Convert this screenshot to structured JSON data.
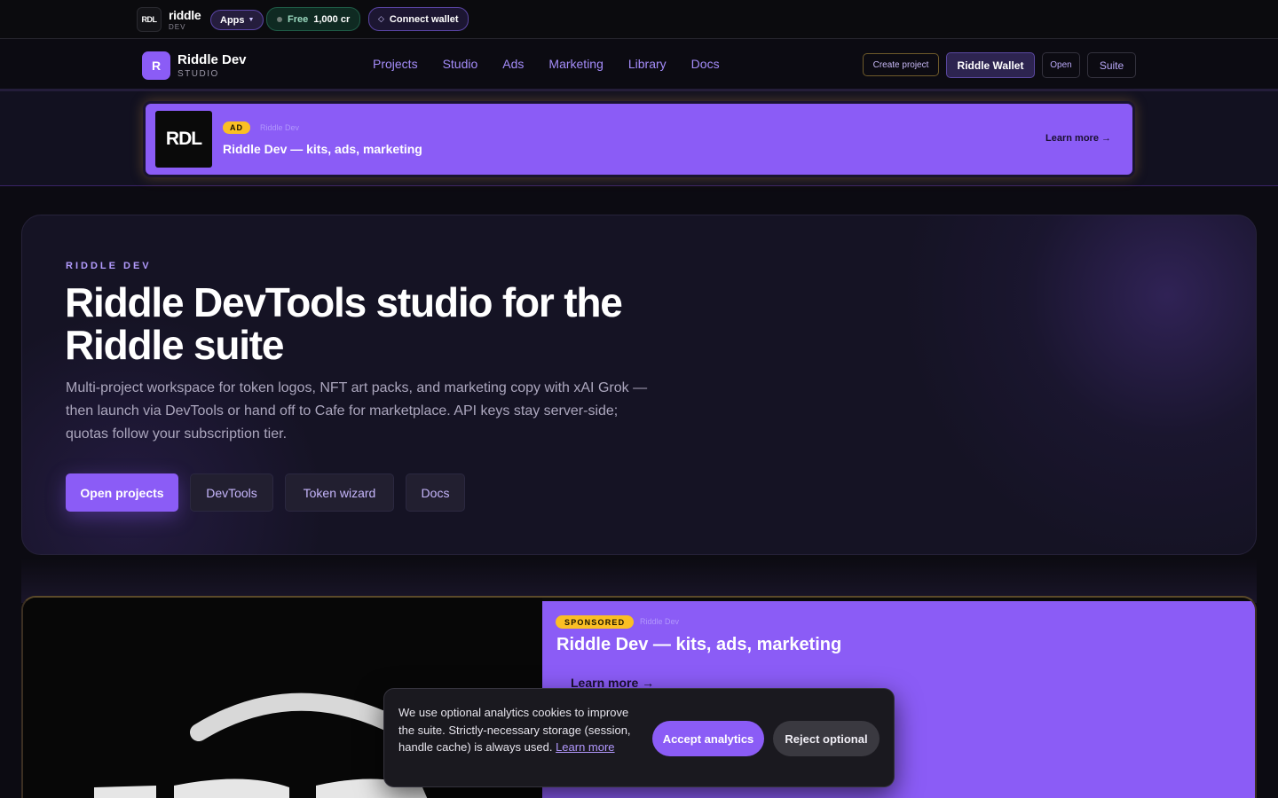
{
  "topstrip": {
    "brand_badge": "RDL",
    "brand_name": "riddle",
    "brand_sub": "DEV",
    "apps_label": "Apps",
    "free_label": "Free",
    "free_credits": "1,000 cr",
    "connect_wallet_label": "Connect wallet"
  },
  "nav": {
    "logo_letter": "R",
    "app_name": "Riddle Dev",
    "app_sub": "STUDIO",
    "links": [
      "Projects",
      "Studio",
      "Ads",
      "Marketing",
      "Library",
      "Docs"
    ],
    "create_project": "Create project",
    "riddle_wallet": "Riddle Wallet",
    "open": "Open",
    "suite": "Suite"
  },
  "ad_bar": {
    "logo_text": "RDL",
    "tag": "AD",
    "source": "Riddle Dev",
    "title": "Riddle Dev — kits, ads, marketing",
    "learn_more": "Learn more →"
  },
  "hero": {
    "eyebrow": "RIDDLE DEV",
    "title": "Riddle DevTools studio for the Riddle suite",
    "description": "Multi-project workspace for token logos, NFT art packs, and marketing copy with xAI Grok — then launch via DevTools or hand off to Cafe for marketplace. API keys stay server-side; quotas follow your subscription tier.",
    "buttons": {
      "open_projects": "Open projects",
      "devtools": "DevTools",
      "token_wizard": "Token wizard",
      "docs": "Docs"
    }
  },
  "sponsored": {
    "tag": "SPONSORED",
    "source": "Riddle Dev",
    "title": "Riddle Dev — kits, ads, marketing",
    "learn_more": "Learn more →"
  },
  "cookie": {
    "text": "We use optional analytics cookies to improve the suite. Strictly-necessary storage (session, handle cache) is always used.",
    "learn_more": "Learn more",
    "accept": "Accept analytics",
    "reject": "Reject optional"
  },
  "colors": {
    "accent": "#8b5cf6",
    "background": "#0c0b12",
    "tag_yellow": "#fbbf24"
  },
  "icons": {
    "apps_caret": "chevron-down-icon",
    "free_status": "status-dot-icon",
    "wallet": "diamond-icon",
    "arrow": "arrow-right-icon"
  }
}
